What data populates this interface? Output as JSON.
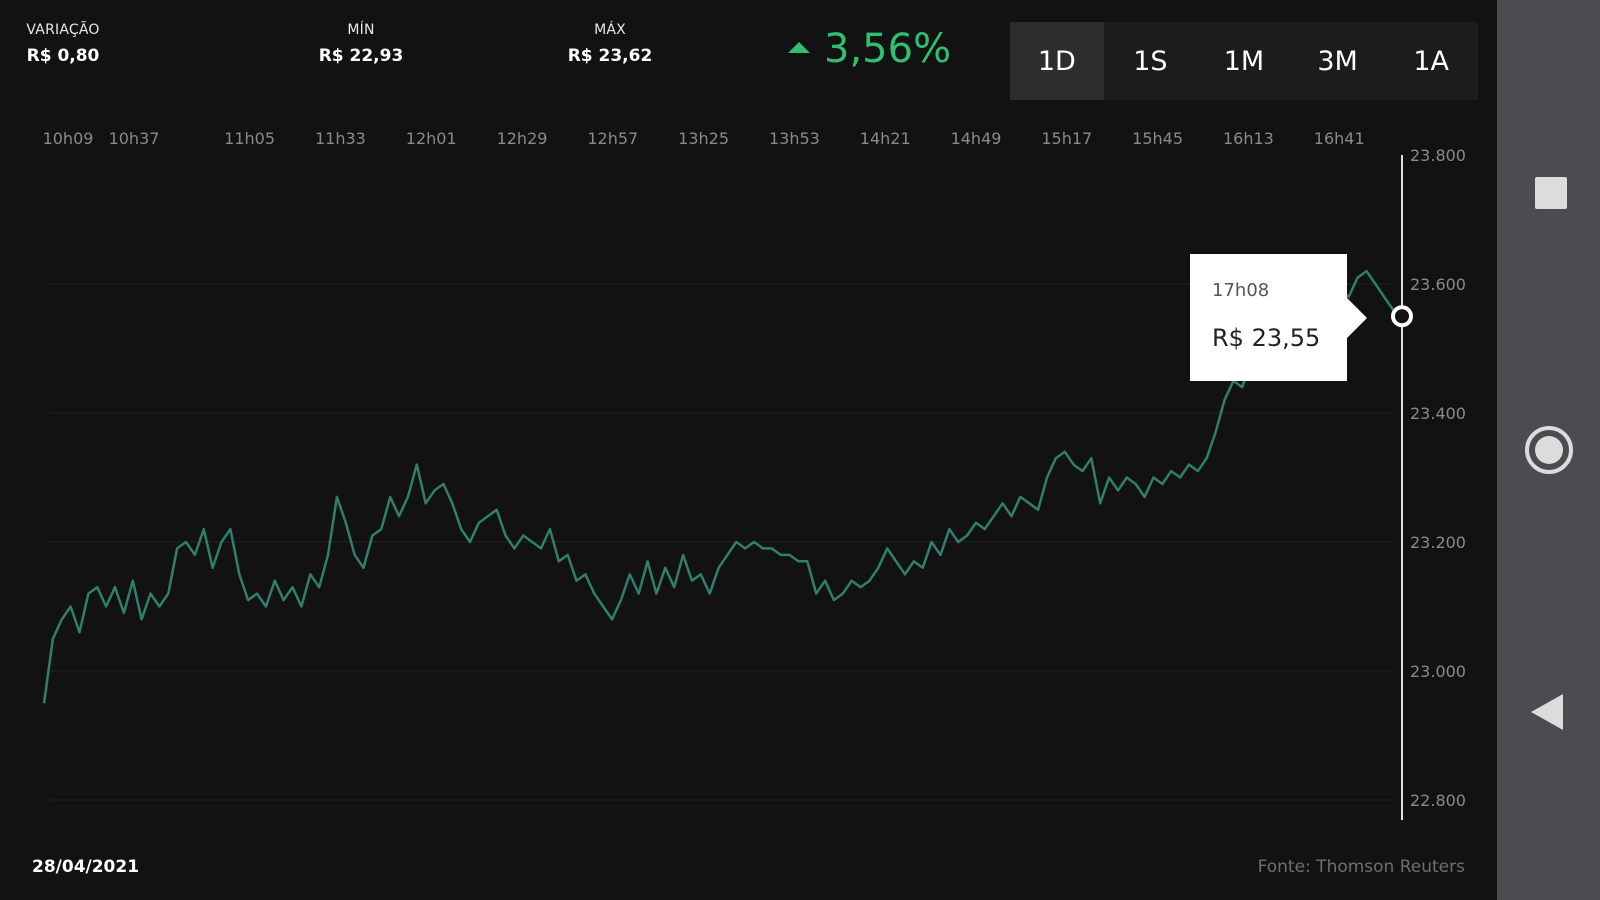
{
  "header": {
    "variacao": {
      "label": "VARIAÇÃO",
      "value": "R$ 0,80"
    },
    "min": {
      "label": "MÍN",
      "value": "R$ 22,93"
    },
    "max": {
      "label": "MÁX",
      "value": "R$ 23,62"
    },
    "change_pct": "3,56%"
  },
  "period_tabs": [
    {
      "label": "1D",
      "active": true
    },
    {
      "label": "1S",
      "active": false
    },
    {
      "label": "1M",
      "active": false
    },
    {
      "label": "3M",
      "active": false
    },
    {
      "label": "1A",
      "active": false
    }
  ],
  "tooltip": {
    "time": "17h08",
    "price": "R$ 23,55"
  },
  "footer": {
    "date": "28/04/2021",
    "source": "Fonte: Thomson Reuters"
  },
  "colors": {
    "line": "#2f7f6c",
    "positive": "#2fbf71",
    "background": "#121212"
  },
  "icons": {
    "nav_square": "recent-apps-icon",
    "nav_circle": "home-icon",
    "nav_back": "back-icon"
  },
  "chart_data": {
    "type": "line",
    "x_tick_labels": [
      "10h09",
      "10h37",
      "11h05",
      "11h33",
      "12h01",
      "12h29",
      "12h57",
      "13h25",
      "13h53",
      "14h21",
      "14h49",
      "15h17",
      "15h45",
      "16h13",
      "16h41"
    ],
    "y_tick_labels": [
      "23.800",
      "23.600",
      "23.400",
      "23.200",
      "23.000",
      "22.800"
    ],
    "y_ticks": [
      23.8,
      23.6,
      23.4,
      23.2,
      23.0,
      22.8
    ],
    "ylim": [
      22.8,
      23.8
    ],
    "x_start_time": "10h09",
    "x_end_time": "17h08",
    "grid": true,
    "series": [
      {
        "values": [
          22.95,
          23.05,
          23.08,
          23.1,
          23.06,
          23.12,
          23.13,
          23.1,
          23.13,
          23.09,
          23.14,
          23.08,
          23.12,
          23.1,
          23.12,
          23.19,
          23.2,
          23.18,
          23.22,
          23.16,
          23.2,
          23.22,
          23.15,
          23.11,
          23.12,
          23.1,
          23.14,
          23.11,
          23.13,
          23.1,
          23.15,
          23.13,
          23.18,
          23.27,
          23.23,
          23.18,
          23.16,
          23.21,
          23.22,
          23.27,
          23.24,
          23.27,
          23.32,
          23.26,
          23.28,
          23.29,
          23.26,
          23.22,
          23.2,
          23.23,
          23.24,
          23.25,
          23.21,
          23.19,
          23.21,
          23.2,
          23.19,
          23.22,
          23.17,
          23.18,
          23.14,
          23.15,
          23.12,
          23.1,
          23.08,
          23.11,
          23.15,
          23.12,
          23.17,
          23.12,
          23.16,
          23.13,
          23.18,
          23.14,
          23.15,
          23.12,
          23.16,
          23.18,
          23.2,
          23.19,
          23.2,
          23.19,
          23.19,
          23.18,
          23.18,
          23.17,
          23.17,
          23.12,
          23.14,
          23.11,
          23.12,
          23.14,
          23.13,
          23.14,
          23.16,
          23.19,
          23.17,
          23.15,
          23.17,
          23.16,
          23.2,
          23.18,
          23.22,
          23.2,
          23.21,
          23.23,
          23.22,
          23.24,
          23.26,
          23.24,
          23.27,
          23.26,
          23.25,
          23.3,
          23.33,
          23.34,
          23.32,
          23.31,
          23.33,
          23.26,
          23.3,
          23.28,
          23.3,
          23.29,
          23.27,
          23.3,
          23.29,
          23.31,
          23.3,
          23.32,
          23.31,
          23.33,
          23.37,
          23.42,
          23.45,
          23.44,
          23.48,
          23.47,
          23.5,
          23.52,
          23.49,
          23.53,
          23.55,
          23.58,
          23.6,
          23.57,
          23.59,
          23.58,
          23.61,
          23.62,
          23.6,
          23.58,
          23.56,
          23.55
        ]
      }
    ]
  }
}
